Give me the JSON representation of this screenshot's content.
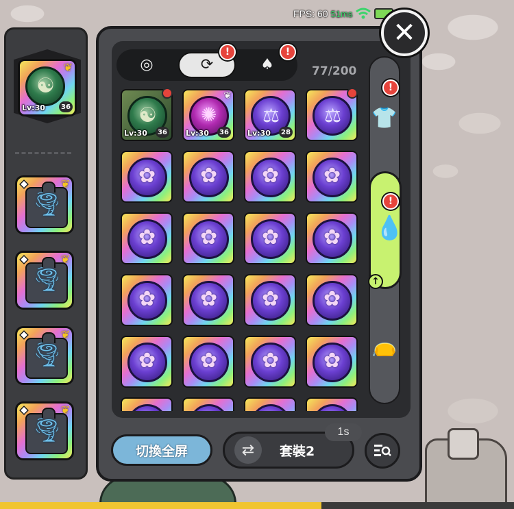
{
  "status": {
    "fps_label": "FPS: 60",
    "latency": "51ms"
  },
  "tabs": [
    {
      "icon": "spiral-emblem-icon",
      "alert": false
    },
    {
      "icon": "swirl-emblem-icon",
      "alert": true
    },
    {
      "icon": "card-icon",
      "alert": true
    }
  ],
  "inventory": {
    "count": "77/200"
  },
  "equipped": {
    "level": "Lv:30",
    "count": "36"
  },
  "items": [
    {
      "type": "dragon",
      "level": "Lv:30",
      "count": "36",
      "dot": true
    },
    {
      "type": "rune",
      "level": "Lv:30",
      "count": "36",
      "dot": false
    },
    {
      "type": "libra",
      "level": "Lv:30",
      "count": "28",
      "dot": false
    },
    {
      "type": "libra",
      "level": "",
      "count": "",
      "dot": true
    }
  ],
  "set_rail": [
    {
      "icon": "tunic-icon",
      "alert": true,
      "active": false
    },
    {
      "icon": "water-drop-icon",
      "alert": true,
      "active": true
    },
    {
      "icon": "pouch-icon",
      "alert": false,
      "active": false
    }
  ],
  "bottom": {
    "fullscreen_label": "切換全屏",
    "set_label": "套裝2",
    "timer": "1s"
  },
  "alert_glyph": "!",
  "close_glyph": "✕",
  "colors": {
    "accent_green": "#c8f270",
    "alert_red": "#e6443c",
    "button_blue": "#7cb6d9",
    "xp_yellow": "#f0c531"
  },
  "xp_progress": 0.625
}
